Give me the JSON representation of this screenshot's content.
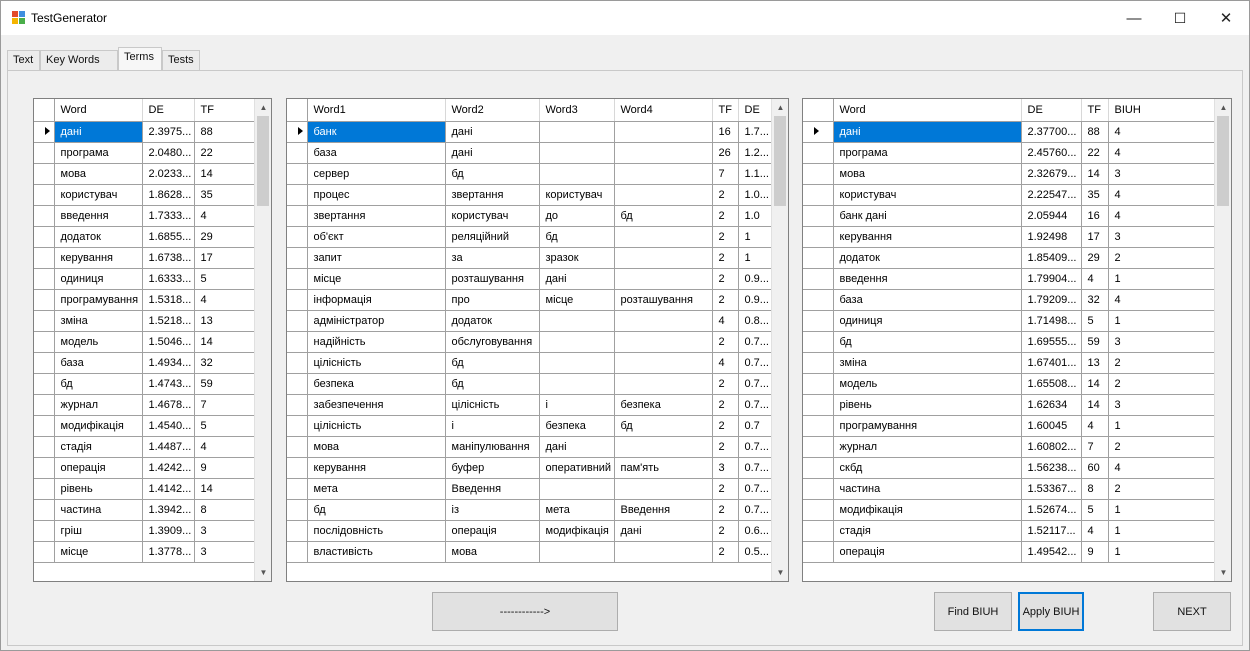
{
  "window": {
    "title": "TestGenerator",
    "controls": {
      "minimize": "—",
      "maximize": "☐",
      "close": "✕"
    }
  },
  "tabs": [
    {
      "label": "Text"
    },
    {
      "label": "Key Words"
    },
    {
      "label": "Terms"
    },
    {
      "label": "Tests"
    }
  ],
  "active_tab": "Terms",
  "grid1": {
    "columns": [
      "Word",
      "DE",
      "TF"
    ],
    "rows": [
      [
        "дані",
        "2.3975...",
        "88"
      ],
      [
        "програма",
        "2.0480...",
        "22"
      ],
      [
        "мова",
        "2.0233...",
        "14"
      ],
      [
        "користувач",
        "1.8628...",
        "35"
      ],
      [
        "введення",
        "1.7333...",
        "4"
      ],
      [
        "додаток",
        "1.6855...",
        "29"
      ],
      [
        "керування",
        "1.6738...",
        "17"
      ],
      [
        "одиниця",
        "1.6333...",
        "5"
      ],
      [
        "програмування",
        "1.5318...",
        "4"
      ],
      [
        "зміна",
        "1.5218...",
        "13"
      ],
      [
        "модель",
        "1.5046...",
        "14"
      ],
      [
        "база",
        "1.4934...",
        "32"
      ],
      [
        "бд",
        "1.4743...",
        "59"
      ],
      [
        "журнал",
        "1.4678...",
        "7"
      ],
      [
        "модифікація",
        "1.4540...",
        "5"
      ],
      [
        "стадія",
        "1.4487...",
        "4"
      ],
      [
        "операція",
        "1.4242...",
        "9"
      ],
      [
        "рівень",
        "1.4142...",
        "14"
      ],
      [
        "частина",
        "1.3942...",
        "8"
      ],
      [
        "гріш",
        "1.3909...",
        "3"
      ],
      [
        "місце",
        "1.3778...",
        "3"
      ]
    ]
  },
  "grid2": {
    "columns": [
      "Word1",
      "Word2",
      "Word3",
      "Word4",
      "TF",
      "DE"
    ],
    "rows": [
      [
        "банк",
        "дані",
        "",
        "",
        "16",
        "1.7..."
      ],
      [
        "база",
        "дані",
        "",
        "",
        "26",
        "1.2..."
      ],
      [
        "сервер",
        "бд",
        "",
        "",
        "7",
        "1.1..."
      ],
      [
        "процес",
        "звертання",
        "користувач",
        "",
        "2",
        "1.0..."
      ],
      [
        "звертання",
        "користувач",
        "до",
        "бд",
        "2",
        "1.0"
      ],
      [
        "об'єкт",
        "реляційний",
        "бд",
        "",
        "2",
        "1"
      ],
      [
        "запит",
        "за",
        "зразок",
        "",
        "2",
        "1"
      ],
      [
        "місце",
        "розташування",
        "дані",
        "",
        "2",
        "0.9..."
      ],
      [
        "інформація",
        "про",
        "місце",
        "розташування",
        "2",
        "0.9..."
      ],
      [
        "адміністратор",
        "додаток",
        "",
        "",
        "4",
        "0.8..."
      ],
      [
        "надійність",
        "обслуговування",
        "",
        "",
        "2",
        "0.7..."
      ],
      [
        "цілісність",
        "бд",
        "",
        "",
        "4",
        "0.7..."
      ],
      [
        "безпека",
        "бд",
        "",
        "",
        "2",
        "0.7..."
      ],
      [
        "забезпечення",
        "цілісність",
        "і",
        "безпека",
        "2",
        "0.7..."
      ],
      [
        "цілісність",
        "і",
        "безпека",
        "бд",
        "2",
        "0.7"
      ],
      [
        "мова",
        "маніпулювання",
        "дані",
        "",
        "2",
        "0.7..."
      ],
      [
        "керування",
        "буфер",
        "оперативний",
        "пам'ять",
        "3",
        "0.7..."
      ],
      [
        "мета",
        "Введення",
        "",
        "",
        "2",
        "0.7..."
      ],
      [
        "бд",
        "із",
        "мета",
        "Введення",
        "2",
        "0.7..."
      ],
      [
        "послідовність",
        "операція",
        "модифікація",
        "дані",
        "2",
        "0.6..."
      ],
      [
        "властивість",
        "мова",
        "",
        "",
        "2",
        "0.5..."
      ]
    ]
  },
  "grid3": {
    "columns": [
      "Word",
      "DE",
      "TF",
      "BIUH"
    ],
    "rows": [
      [
        "дані",
        "2.37700...",
        "88",
        "4"
      ],
      [
        "програма",
        "2.45760...",
        "22",
        "4"
      ],
      [
        "мова",
        "2.32679...",
        "14",
        "3"
      ],
      [
        "користувач",
        "2.22547...",
        "35",
        "4"
      ],
      [
        "банк дані",
        "2.05944",
        "16",
        "4"
      ],
      [
        "керування",
        "1.92498",
        "17",
        "3"
      ],
      [
        "додаток",
        "1.85409...",
        "29",
        "2"
      ],
      [
        "введення",
        "1.79904...",
        "4",
        "1"
      ],
      [
        "база",
        "1.79209...",
        "32",
        "4"
      ],
      [
        "одиниця",
        "1.71498...",
        "5",
        "1"
      ],
      [
        "бд",
        "1.69555...",
        "59",
        "3"
      ],
      [
        "зміна",
        "1.67401...",
        "13",
        "2"
      ],
      [
        "модель",
        "1.65508...",
        "14",
        "2"
      ],
      [
        "рівень",
        "1.62634",
        "14",
        "3"
      ],
      [
        "програмування",
        "1.60045",
        "4",
        "1"
      ],
      [
        "журнал",
        "1.60802...",
        "7",
        "2"
      ],
      [
        "скбд",
        "1.56238...",
        "60",
        "4"
      ],
      [
        "частина",
        "1.53367...",
        "8",
        "2"
      ],
      [
        "модифікація",
        "1.52674...",
        "5",
        "1"
      ],
      [
        "стадія",
        "1.52117...",
        "4",
        "1"
      ],
      [
        "операція",
        "1.49542...",
        "9",
        "1"
      ]
    ]
  },
  "buttons": {
    "arrow": "------------>",
    "find": "Find BIUH",
    "apply": "Apply BIUH",
    "next": "NEXT"
  },
  "scroll_arrows": {
    "up": "▲",
    "down": "▼"
  }
}
